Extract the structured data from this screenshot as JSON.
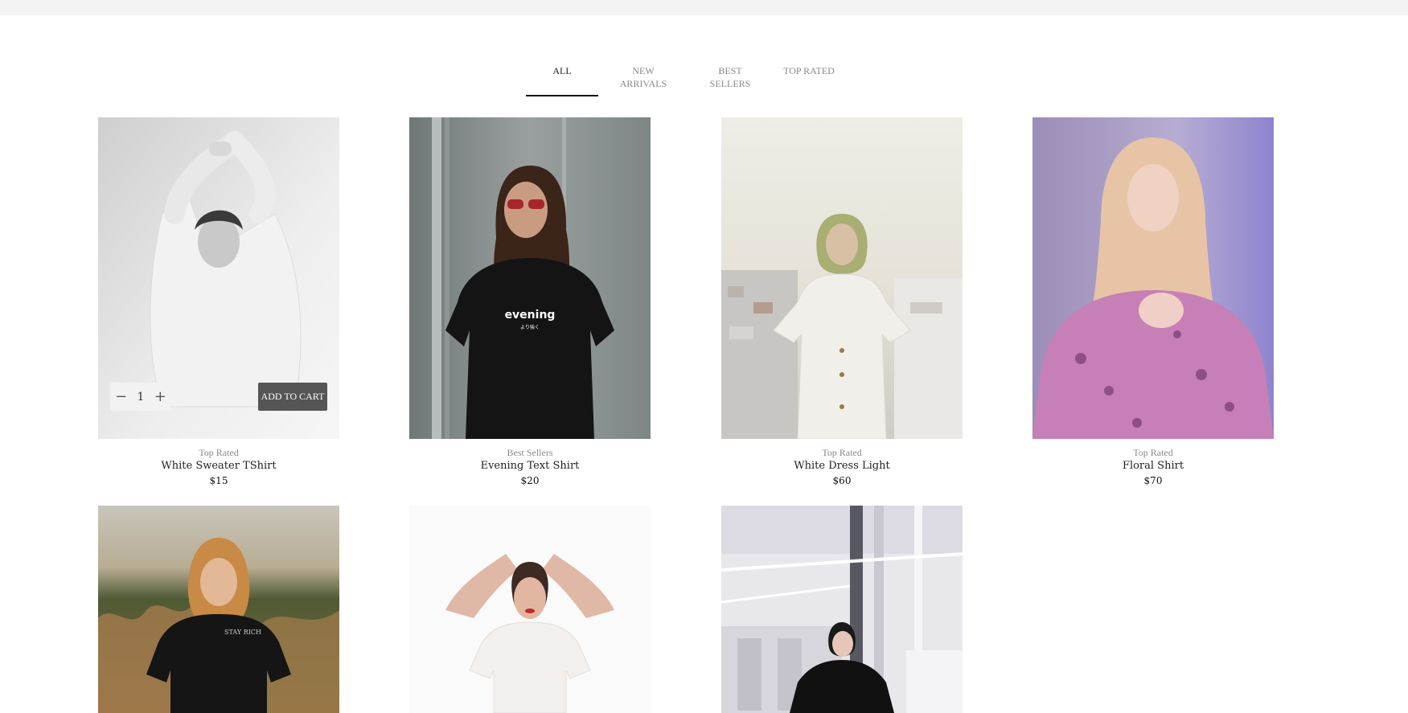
{
  "tabs": [
    {
      "label": "ALL",
      "active": true
    },
    {
      "label": "NEW ARRIVALS",
      "active": false
    },
    {
      "label": "BEST SELLERS",
      "active": false
    },
    {
      "label": "TOP RATED",
      "active": false
    }
  ],
  "products": [
    {
      "category": "Top Rated",
      "name": "White Sweater TShirt",
      "price": "$15",
      "quantity": "1",
      "add_to_cart": "ADD TO CART"
    },
    {
      "category": "Best Sellers",
      "name": "Evening Text Shirt",
      "price": "$20"
    },
    {
      "category": "Top Rated",
      "name": "White Dress Light",
      "price": "$60"
    },
    {
      "category": "Top Rated",
      "name": "Floral Shirt",
      "price": "$70"
    },
    {
      "category": "",
      "name": "",
      "price": ""
    },
    {
      "category": "",
      "name": "",
      "price": ""
    },
    {
      "category": "",
      "name": "",
      "price": ""
    }
  ],
  "shirt_prints": {
    "evening": "evening",
    "evening_sub": "より強く",
    "stay_rich": "STAY RICH"
  }
}
